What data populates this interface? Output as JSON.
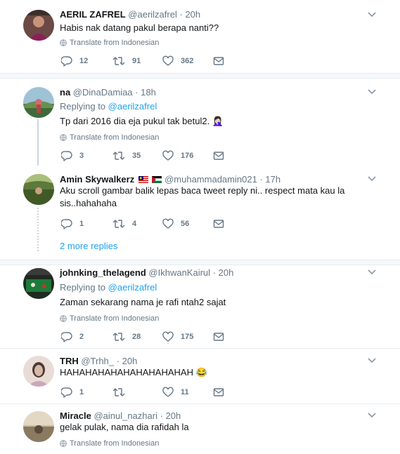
{
  "tweets": [
    {
      "name": "AERIL ZAFREL",
      "handle": "@aerilzafrel",
      "time": "20h",
      "text": "Habis nak datang pakul berapa nanti??",
      "translate": "Translate from Indonesian",
      "replies": "12",
      "retweets": "91",
      "likes": "362"
    },
    {
      "name": "na",
      "handle": "@DinaDamiaa",
      "time": "18h",
      "replying_prefix": "Replying to",
      "replying_to": "@aerilzafrel",
      "text": "Tp dari 2016 dia eja pukul tak betul2. 🤦🏻‍♀️",
      "translate": "Translate from Indonesian",
      "replies": "3",
      "retweets": "35",
      "likes": "176"
    },
    {
      "name": "Amin Skywalkerz",
      "handle": "@muhammadamin021",
      "time": "17h",
      "text": "Aku scroll gambar balik lepas baca tweet reply ni.. respect mata kau la sis..hahahaha",
      "replies": "1",
      "retweets": "4",
      "likes": "56"
    },
    {
      "name": "johnking_thelagend",
      "handle": "@IkhwanKairul",
      "time": "20h",
      "replying_prefix": "Replying to",
      "replying_to": "@aerilzafrel",
      "text": "Zaman sekarang nama je rafi ntah2 sajat",
      "translate": "Translate from Indonesian",
      "replies": "2",
      "retweets": "28",
      "likes": "175"
    },
    {
      "name": "TRH",
      "handle": "@Trhh_",
      "time": "20h",
      "text": "HAHAHAHAHAHAHAHAHAHAH 😂",
      "replies": "1",
      "retweets": "",
      "likes": "11"
    },
    {
      "name": "Miracle",
      "handle": "@ainul_nazhari",
      "time": "20h",
      "text": "gelak pulak, nama dia rafidah la",
      "translate": "Translate from Indonesian"
    }
  ],
  "more_replies": "2 more replies",
  "separator": "·",
  "colors": {
    "link": "#1da1f2",
    "muted": "#657786",
    "text": "#14171a"
  }
}
